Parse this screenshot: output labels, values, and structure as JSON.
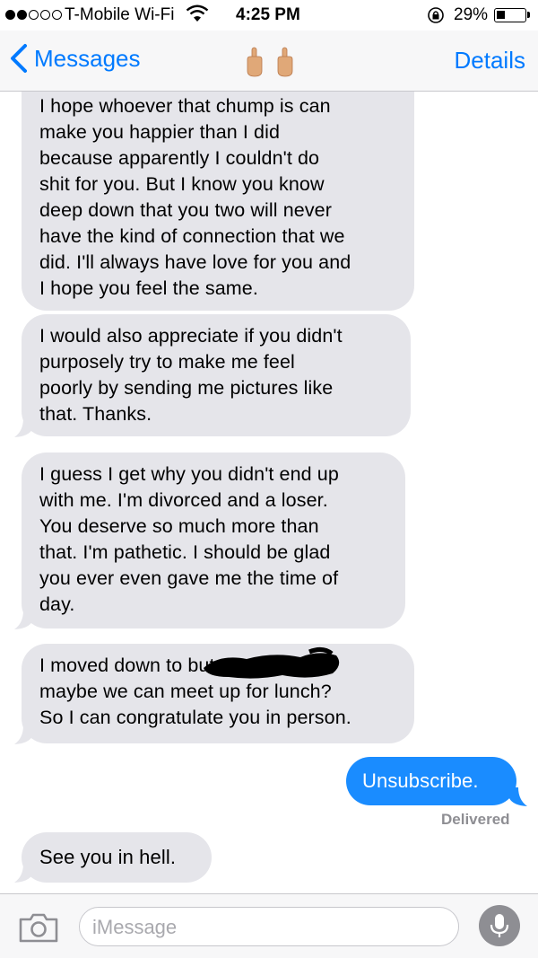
{
  "status_bar": {
    "carrier": "T-Mobile Wi-Fi",
    "time": "4:25 PM",
    "battery_percent": "29%",
    "signal_bars_filled": 2,
    "signal_bars_total": 5
  },
  "nav": {
    "back_label": "Messages",
    "contact_icon": "middle-finger-emoji-pair",
    "details_label": "Details"
  },
  "messages": [
    {
      "direction": "incoming",
      "text": "I hope whoever that chump is can\nmake you happier than I did\nbecause apparently I couldn't do\nshit for you. But I know you know\ndeep down that you two will never\nhave the kind of connection that we\ndid. I'll always have love for you and\nI hope you feel the same."
    },
    {
      "direction": "incoming",
      "text": "I would also appreciate if you didn't\npurposely try to make me feel\npoorly by sending me pictures like\nthat. Thanks."
    },
    {
      "direction": "incoming",
      "text": "I guess I get why you didn't end up\nwith me. I'm divorced and a loser.\nYou deserve so much more than\nthat. I'm pathetic. I should be glad\nyou ever even gave me the time of\nday."
    },
    {
      "direction": "incoming",
      "text": "I moved down to                          but\nmaybe we can meet up for lunch?\nSo I can congratulate you in person."
    },
    {
      "direction": "outgoing",
      "text": "Unsubscribe."
    },
    {
      "direction": "incoming",
      "text": "See you in hell."
    }
  ],
  "delivered_label": "Delivered",
  "composer": {
    "placeholder": "iMessage"
  },
  "colors": {
    "ios_blue": "#007aff",
    "outgoing_bubble": "#1a8cff",
    "incoming_bubble": "#e5e5ea"
  }
}
